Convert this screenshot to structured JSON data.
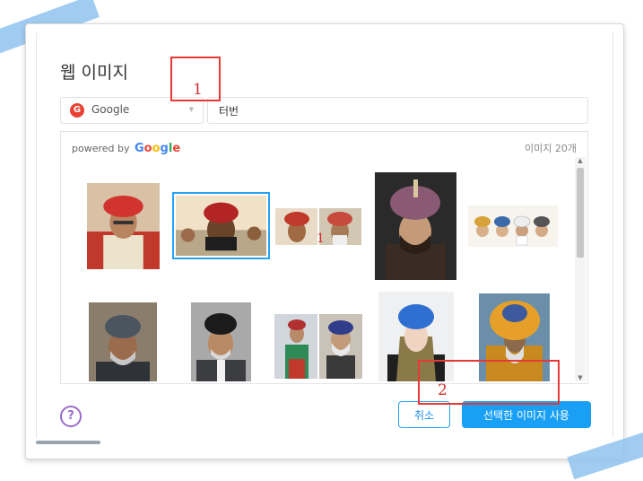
{
  "dialog": {
    "title": "웹 이미지",
    "source": {
      "label": "Google",
      "icon": "google-g-icon"
    },
    "search": {
      "value": "터번"
    },
    "results": {
      "powered_prefix": "powered by",
      "powered_brand": "Google",
      "count": "이미지 20개"
    },
    "buttons": {
      "cancel": "취소",
      "use": "선택한 이미지 사용"
    },
    "help_icon": "question-mark-icon"
  },
  "annotations": {
    "search_marker": "1",
    "thumb_marker": "1",
    "button_marker": "2"
  },
  "colors": {
    "accent": "#19a0f5",
    "annotation_red": "#e53935",
    "help_purple": "#9b6bcc",
    "tape_blue": "#8fc3ee"
  }
}
